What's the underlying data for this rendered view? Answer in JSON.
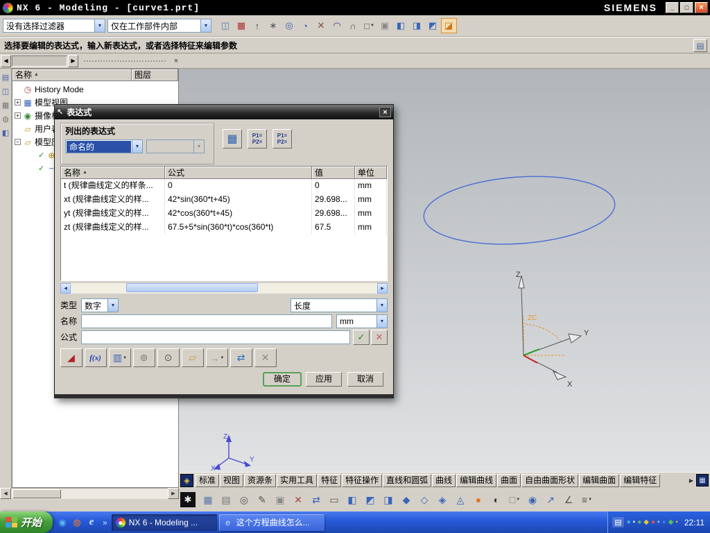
{
  "ui": {
    "dd": "▼",
    "left": "◀",
    "right": "▶",
    "up": "▲",
    "x": "×",
    "back": "◀",
    "fwd": "▶"
  },
  "window": {
    "title": "NX 6 - Modeling - [curve1.prt]",
    "brand": "SIEMENS",
    "controls": {
      "minimize": "_",
      "maximize": "□",
      "close": "×"
    }
  },
  "toolbar": {
    "filter_combo": "没有选择过滤器",
    "scope_combo": "仅在工作部件内部",
    "icons": [
      {
        "name": "work-part-icon",
        "glyph": "◫",
        "color": "#5b79b5"
      },
      {
        "name": "grid-snap-icon",
        "glyph": "▦",
        "color": "#b03030"
      },
      {
        "name": "endpoint-snap-icon",
        "glyph": "↑",
        "color": "#444444"
      },
      {
        "name": "midpoint-snap-icon",
        "glyph": "∗",
        "color": "#555555"
      },
      {
        "name": "center-snap-icon",
        "glyph": "◎",
        "color": "#3a5fae"
      },
      {
        "name": "quadrant-snap-icon",
        "glyph": "◔",
        "color": "#3a5fae"
      },
      {
        "name": "intersection-snap-icon",
        "glyph": "✕",
        "color": "#884444"
      },
      {
        "name": "arc-snap-icon",
        "glyph": "◠",
        "color": "#333388"
      },
      {
        "name": "tangent-snap-icon",
        "glyph": "∩",
        "color": "#555555"
      },
      {
        "name": "selection-rect-icon",
        "glyph": "□",
        "color": "#555555",
        "dd": "▼"
      },
      {
        "name": "general-object-icon",
        "glyph": "▣",
        "color": "#888888"
      },
      {
        "name": "view-cube-front-icon",
        "glyph": "◧",
        "color": "#3a66b8"
      },
      {
        "name": "view-cube-side-icon",
        "glyph": "◨",
        "color": "#3a66b8"
      },
      {
        "name": "view-cube-top-icon",
        "glyph": "◩",
        "color": "#3a66b8"
      },
      {
        "name": "shaded-view-icon",
        "glyph": "◪",
        "color": "#c87820",
        "active": true
      }
    ]
  },
  "prompt": {
    "text": "选择要编辑的表达式，输入新表达式，或者选择特征来编辑参数",
    "side_icon": "▤"
  },
  "resource_bar": {
    "icons": [
      {
        "name": "assembly-navigator-icon",
        "glyph": "▤",
        "color": "#4a62a8"
      },
      {
        "name": "part-navigator-icon",
        "glyph": "◫",
        "color": "#4a62a8"
      },
      {
        "name": "reuse-library-icon",
        "glyph": "▦",
        "color": "#777777"
      },
      {
        "name": "history-palette-icon",
        "glyph": "◍",
        "color": "#777777"
      },
      {
        "name": "roles-icon",
        "glyph": "◧",
        "color": "#4a62a8"
      }
    ]
  },
  "navigator": {
    "name_col": "名称",
    "layer_col": "图层",
    "items": [
      {
        "expander": "",
        "check": "",
        "glyph": "◷",
        "color": "#aa4444",
        "label": "History Mode",
        "sub": false
      },
      {
        "expander": "+",
        "check": "",
        "glyph": "▦",
        "color": "#3a66b8",
        "label": "模型视图",
        "sub": false
      },
      {
        "expander": "+",
        "check": "",
        "glyph": "◉",
        "color": "#3a8a3a",
        "label": "摄像机",
        "sub": false
      },
      {
        "expander": "",
        "check": "",
        "glyph": "▱",
        "color": "#c8962a",
        "label": "用户表达式",
        "sub": false
      },
      {
        "expander": "−",
        "check": "",
        "glyph": "▱",
        "color": "#c8962a",
        "label": "模型历史记录",
        "sub": false
      },
      {
        "expander": "",
        "check": "✓",
        "glyph": "⊕",
        "color": "#b8860b",
        "label": "",
        "sub": true
      },
      {
        "expander": "",
        "check": "✓",
        "glyph": "~",
        "color": "#3a66b8",
        "label": "",
        "sub": true
      }
    ]
  },
  "dialog": {
    "title": "表达式",
    "title_icon": "↖",
    "listed_label": "列出的表达式",
    "listed_combo": "命名的",
    "top_buttons": [
      {
        "name": "edit-in-spreadsheet-icon",
        "glyph": "▦",
        "color": "#2f5fae",
        "big": true
      },
      {
        "name": "formula-view-icon",
        "glyph": "P1=\nP2=",
        "color": "#223a8a",
        "two": true
      },
      {
        "name": "value-view-icon",
        "glyph": "P1=\nP2=",
        "color": "#223a8a",
        "two": true
      }
    ],
    "col_name": "名称",
    "col_formula": "公式",
    "col_value": "值",
    "col_unit": "单位",
    "rows": [
      {
        "name": "t (规律曲线定义的样条...",
        "formula": "0",
        "value": "0",
        "unit": "mm"
      },
      {
        "name": "xt (规律曲线定义的样...",
        "formula": "42*sin(360*t+45)",
        "value": "29.698...",
        "unit": "mm"
      },
      {
        "name": "yt (规律曲线定义的样...",
        "formula": "42*cos(360*t+45)",
        "value": "29.698...",
        "unit": "mm"
      },
      {
        "name": "zt (规律曲线定义的样...",
        "formula": "67.5+5*sin(360*t)*cos(360*t)",
        "value": "67.5",
        "unit": "mm"
      }
    ],
    "type_label": "类型",
    "type_value": "数字",
    "dim_value": "长度",
    "name_label": "名称",
    "name_value": "",
    "unit_value": "mm",
    "formula_label": "公式",
    "formula_value": "",
    "accept_glyph": "✓",
    "reject_glyph": "✕",
    "tool_icons": [
      {
        "name": "no-autoupdate-icon",
        "glyph": "◢",
        "color": "#b22222"
      },
      {
        "name": "function-editor-icon",
        "glyph": "f(x)",
        "color": "#1a3fb0",
        "fx": true
      },
      {
        "name": "measure-icon",
        "glyph": "▥",
        "color": "#3a5fae",
        "dd": "▼"
      },
      {
        "name": "interpart-reference-icon",
        "glyph": "⊚",
        "color": "#777777"
      },
      {
        "name": "interpart-find-icon",
        "glyph": "⊙",
        "color": "#555555"
      },
      {
        "name": "import-expressions-icon",
        "glyph": "▱",
        "color": "#c8962a"
      },
      {
        "name": "export-expressions-icon",
        "glyph": "→",
        "color": "#999999",
        "dd": "▼"
      },
      {
        "name": "update-values-icon",
        "glyph": "⇄",
        "color": "#2a6fbf"
      },
      {
        "name": "delete-expression-icon",
        "glyph": "✕",
        "color": "#888888"
      }
    ],
    "ok": "确定",
    "apply": "应用",
    "cancel": "取消"
  },
  "viewport": {
    "curve_color": "#4a6cd4",
    "wcs": {
      "z": "Z",
      "y": "Y",
      "x": "X",
      "zc": "ZC"
    },
    "triad": {
      "z": "Z",
      "y": "Y",
      "x": "X"
    }
  },
  "tabs": {
    "leading_icon": "◈",
    "items": [
      {
        "label": "标准"
      },
      {
        "label": "视图"
      },
      {
        "label": "资源条"
      },
      {
        "label": "实用工具"
      },
      {
        "label": "特征"
      },
      {
        "label": "特征操作"
      },
      {
        "label": "直线和圆弧"
      },
      {
        "label": "曲线"
      },
      {
        "label": "编辑曲线"
      },
      {
        "label": "曲面"
      },
      {
        "label": "自由曲面形状"
      },
      {
        "label": "编辑曲面"
      },
      {
        "label": "编辑特征"
      }
    ],
    "trailing_icon": "▦"
  },
  "tools": {
    "gear_icon": "✱",
    "icons": [
      {
        "name": "display-grid-icon",
        "glyph": "▦",
        "color": "#5577aa"
      },
      {
        "name": "layers-icon",
        "glyph": "▤",
        "color": "#777777"
      },
      {
        "name": "zoom-icon",
        "glyph": "◎",
        "color": "#555555"
      },
      {
        "name": "edit-pencil-icon",
        "glyph": "✎",
        "color": "#555555"
      },
      {
        "name": "object-display-icon",
        "glyph": "▣",
        "color": "#888888"
      },
      {
        "name": "delete-icon",
        "glyph": "✕",
        "color": "#aa4444"
      },
      {
        "name": "swap-view-icon",
        "glyph": "⇄",
        "color": "#3a66b8"
      },
      {
        "name": "new-window-icon",
        "glyph": "▭",
        "color": "#555555"
      },
      {
        "name": "cube-front-icon",
        "glyph": "◧",
        "color": "#3a66b8"
      },
      {
        "name": "cube-top-icon",
        "glyph": "◩",
        "color": "#3a66b8"
      },
      {
        "name": "cube-right-icon",
        "glyph": "◨",
        "color": "#3a66b8"
      },
      {
        "name": "cube-iso-icon",
        "glyph": "◆",
        "color": "#3a66b8"
      },
      {
        "name": "cube-trimetric-icon",
        "glyph": "◇",
        "color": "#3a66b8"
      },
      {
        "name": "cube-dimetric-icon",
        "glyph": "◈",
        "color": "#3a66b8"
      },
      {
        "name": "cube-bottom-icon",
        "glyph": "◬",
        "color": "#3a66b8"
      },
      {
        "name": "render-sphere-icon",
        "glyph": "●",
        "color": "#e07820"
      },
      {
        "name": "shaded-wireframe-icon",
        "glyph": "◐",
        "color": "#333333"
      },
      {
        "name": "background-color-icon",
        "glyph": "□",
        "color": "#777777",
        "dd": "▼"
      },
      {
        "name": "orient-view-icon",
        "glyph": "◉",
        "color": "#3a66b8"
      },
      {
        "name": "arrow-up-right-icon",
        "glyph": "↗",
        "color": "#3a66b8"
      },
      {
        "name": "datum-angle-icon",
        "glyph": "∠",
        "color": "#555555"
      },
      {
        "name": "more-tools-icon",
        "glyph": "≡",
        "color": "#555555",
        "dd": "▼"
      }
    ]
  },
  "taskbar": {
    "start": "开始",
    "quick_launch": [
      {
        "name": "messenger-icon",
        "glyph": "◉",
        "color": "#5ab4ec"
      },
      {
        "name": "firefox-icon",
        "glyph": "◍",
        "color": "#e87f2a"
      },
      {
        "name": "ie-icon",
        "glyph": "e",
        "color": "#bfe6ff",
        "ie": true
      }
    ],
    "overflow": "»",
    "tasks": [
      {
        "label": "NX 6 - Modeling ...",
        "active": true,
        "nx": true,
        "glyph": "●",
        "color": "#ffffff"
      },
      {
        "label": "这个方程曲线怎么...",
        "active": false,
        "ie": true,
        "glyph": "e",
        "color": "#bfe6ff"
      }
    ],
    "lang_icon": "▤",
    "tray_icons": [
      {
        "name": "tray-icon-1",
        "glyph": "●",
        "color": "#42b0e8"
      },
      {
        "name": "tray-icon-2",
        "glyph": "▪",
        "color": "#e8e8e8"
      },
      {
        "name": "tray-icon-3",
        "glyph": "●",
        "color": "#58c058"
      },
      {
        "name": "tray-icon-4",
        "glyph": "◆",
        "color": "#e8c83a"
      },
      {
        "name": "tray-icon-5",
        "glyph": "●",
        "color": "#e05050"
      },
      {
        "name": "tray-icon-6",
        "glyph": "▪",
        "color": "#9ad0f0"
      },
      {
        "name": "tray-icon-7",
        "glyph": "●",
        "color": "#3a7ae0"
      },
      {
        "name": "tray-icon-8",
        "glyph": "◆",
        "color": "#58c058"
      },
      {
        "name": "tray-icon-9",
        "glyph": "▪",
        "color": "#e8a23a"
      }
    ],
    "clock": "22:11"
  }
}
